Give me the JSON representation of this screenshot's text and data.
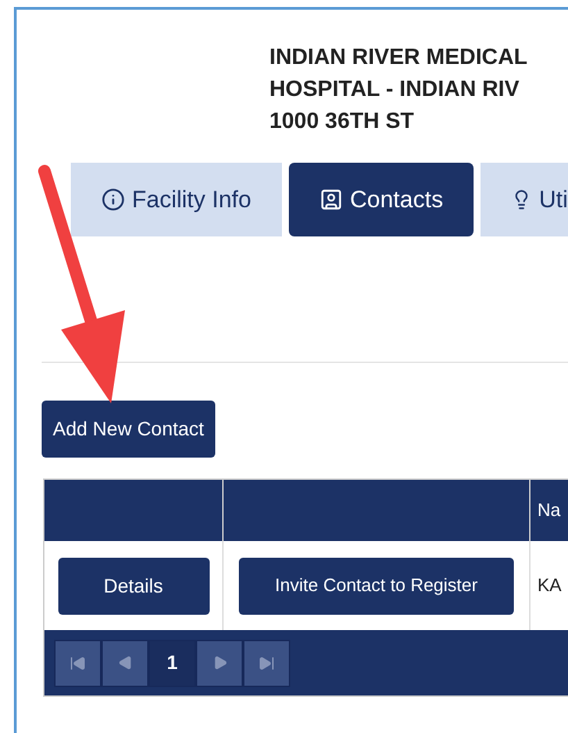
{
  "header": {
    "lines": [
      "INDIAN RIVER MEDICAL",
      "HOSPITAL - INDIAN RIV",
      "1000 36TH ST"
    ]
  },
  "tabs": [
    {
      "label": "Facility Info",
      "kind": "info",
      "selected": false
    },
    {
      "label": "Contacts",
      "kind": "contact",
      "selected": true
    },
    {
      "label": "Uti",
      "kind": "bulb",
      "selected": false
    }
  ],
  "add_button": "Add New Contact",
  "table": {
    "columns": [
      "",
      "",
      "Na"
    ],
    "rows": [
      {
        "details": "Details",
        "invite": "Invite Contact to Register",
        "column_3": "KA"
      }
    ]
  },
  "pager": [
    {
      "kind": "first",
      "disabled": true,
      "selected": false
    },
    {
      "kind": "prev",
      "disabled": true,
      "selected": false
    },
    {
      "kind": "page",
      "label": "1",
      "disabled": false,
      "selected": true
    },
    {
      "kind": "next",
      "disabled": true,
      "selected": false
    },
    {
      "kind": "last",
      "disabled": true,
      "selected": false
    }
  ]
}
